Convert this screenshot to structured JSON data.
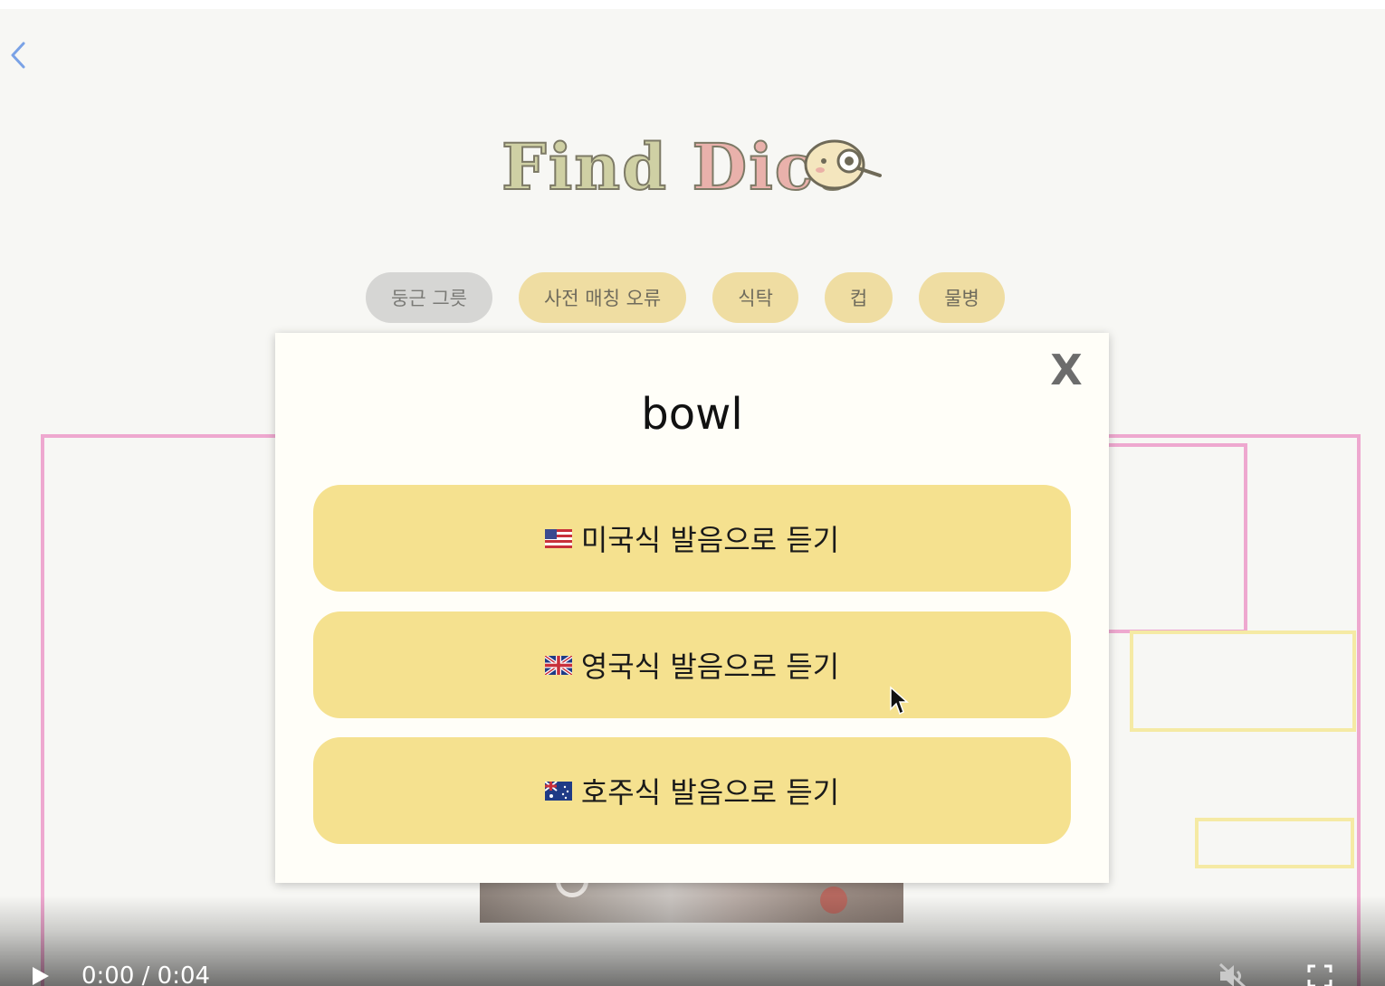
{
  "header": {
    "logo_text_a": "Find",
    "logo_text_b": "Dict"
  },
  "chips": [
    {
      "label": "둥근 그릇",
      "active": true
    },
    {
      "label": "사전 매칭 오류",
      "active": false
    },
    {
      "label": "식탁",
      "active": false
    },
    {
      "label": "컵",
      "active": false
    },
    {
      "label": "물병",
      "active": false
    }
  ],
  "modal": {
    "close_label": "X",
    "word": "bowl",
    "buttons": [
      {
        "flag": "us-flag-icon",
        "label": "미국식 발음으로 듣기"
      },
      {
        "flag": "uk-flag-icon",
        "label": "영국식 발음으로 듣기"
      },
      {
        "flag": "au-flag-icon",
        "label": "호주식 발음으로 듣기"
      }
    ]
  },
  "video_controls": {
    "time": "0:00 / 0:04",
    "muted": true
  },
  "colors": {
    "page_bg": "#f7f7f4",
    "chip_bg": "#efdda2",
    "chip_active_bg": "#d6d6d4",
    "button_bg": "#f5e18f",
    "modal_bg": "#fffef8",
    "box_pink": "#eea8cf",
    "box_yellow": "#f5eaa4",
    "back_arrow": "#7aa2e6"
  }
}
